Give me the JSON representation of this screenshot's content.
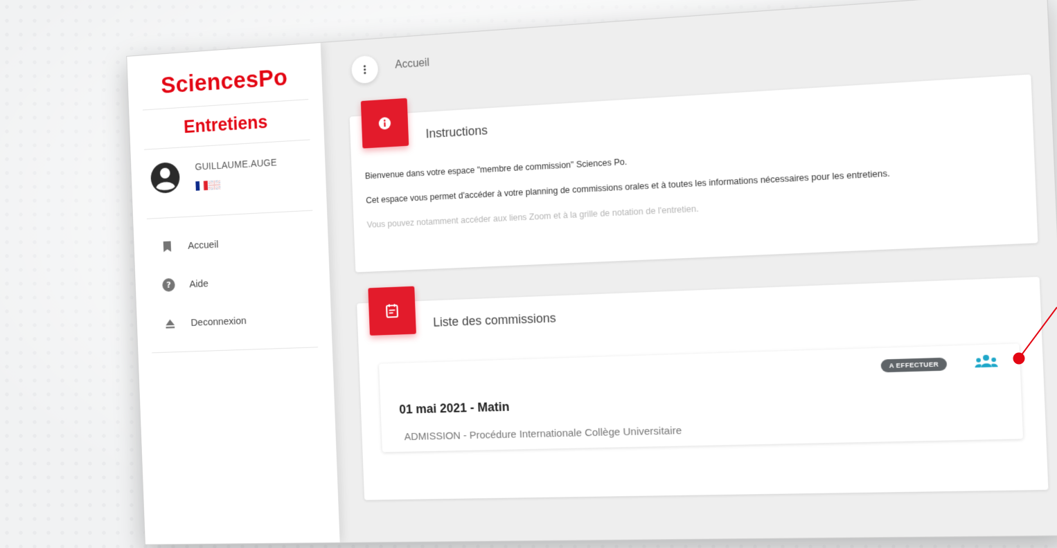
{
  "brand": {
    "logo_text": "SciencesPo",
    "app_name": "Entretiens",
    "accent_color": "#e30613"
  },
  "user": {
    "username": "GUILLAUME.AUGE",
    "avatar_icon": "account-circle-icon",
    "languages": [
      {
        "code": "fr",
        "icon": "flag-fr-icon"
      },
      {
        "code": "en",
        "icon": "flag-uk-icon"
      }
    ]
  },
  "sidebar": {
    "items": [
      {
        "label": "Accueil",
        "icon": "bookmark-icon"
      },
      {
        "label": "Aide",
        "icon": "help-circle-icon"
      },
      {
        "label": "Deconnexion",
        "icon": "eject-icon"
      }
    ]
  },
  "header": {
    "menu_icon": "more-vertical-icon",
    "breadcrumb": "Accueil"
  },
  "instructions": {
    "title": "Instructions",
    "icon": "info-icon",
    "paragraphs": [
      "Bienvenue dans votre espace \"membre de commission\" Sciences Po.",
      "Cet espace vous permet d'accéder à votre planning de commissions orales et à toutes les informations nécessaires pour les entretiens.",
      "Vous pouvez notamment accéder aux liens Zoom et à la grille de notation de l'entretien."
    ]
  },
  "commissions": {
    "title": "Liste des commissions",
    "icon": "calendar-note-icon",
    "items": [
      {
        "status": "A EFFECTUER",
        "date": "01 mai 2021 - Matin",
        "description": "ADMISSION - Procédure Internationale Collège Universitaire",
        "action_icon": "group-icon"
      }
    ]
  },
  "colors": {
    "badge_red": "#e31b2b",
    "status_grey": "#5f6468",
    "people_blue": "#1ea7c9"
  }
}
